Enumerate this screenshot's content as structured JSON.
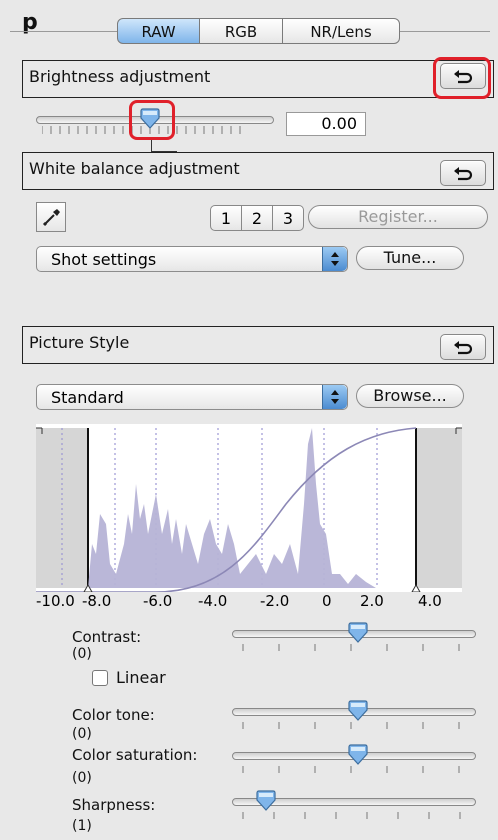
{
  "tabs": [
    {
      "label": "RAW",
      "active": true
    },
    {
      "label": "RGB",
      "active": false
    },
    {
      "label": "NR/Lens",
      "active": false
    }
  ],
  "brightness": {
    "title": "Brightness adjustment",
    "value": "0.00"
  },
  "white_balance": {
    "title": "White balance adjustment",
    "buttons": [
      "1",
      "2",
      "3"
    ],
    "register_label": "Register...",
    "preset_value": "Shot settings",
    "tune_label": "Tune..."
  },
  "picture_style": {
    "title": "Picture Style",
    "style_value": "Standard",
    "browse_label": "Browse...",
    "histogram_axis": [
      "-10.0",
      "-8.0",
      "-6.0",
      "-4.0",
      "-2.0",
      "0",
      "2.0",
      "4.0"
    ]
  },
  "adjustments": [
    {
      "label": "Contrast:",
      "value": "(0)"
    },
    {
      "label": "Color tone:",
      "value": "(0)"
    },
    {
      "label": "Color saturation:",
      "value": "(0)"
    },
    {
      "label": "Sharpness:",
      "value": "(1)"
    }
  ],
  "linear_label": "Linear",
  "colors": {
    "accent_blue": "#7fb5ea",
    "highlight_red": "#e0202a",
    "histogram_fill": "#b6b3d6"
  },
  "icons": {
    "reset": "reset-arrow-icon",
    "eyedropper": "eyedropper-icon",
    "select_arrows": "select-arrows-icon"
  }
}
